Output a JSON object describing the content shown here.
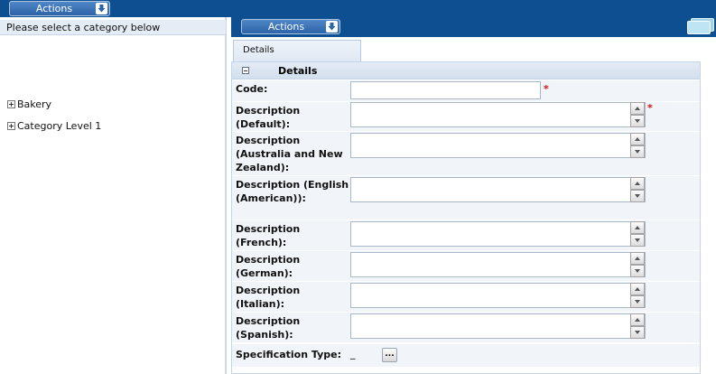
{
  "left_pane": {
    "actions_label": "Actions",
    "header": "Please select a category below",
    "tree": [
      {
        "label": "Bakery"
      },
      {
        "label": "Category Level 1"
      }
    ]
  },
  "right_pane": {
    "actions_label": "Actions",
    "tabs": [
      {
        "label": "Details"
      }
    ],
    "section_title": "Details",
    "fields": [
      {
        "label": "Code:",
        "value": "",
        "required": true
      },
      {
        "label": "Description (Default):",
        "value": "",
        "required": true
      },
      {
        "label": "Description (Australia and New Zealand):",
        "value": "",
        "required": false
      },
      {
        "label": "Description (English (American)):",
        "value": "",
        "required": false
      },
      {
        "label": "Description (French):",
        "value": "",
        "required": false
      },
      {
        "label": "Description (German):",
        "value": "",
        "required": false
      },
      {
        "label": "Description (Italian):",
        "value": "",
        "required": false
      },
      {
        "label": "Description (Spanish):",
        "value": "",
        "required": false
      }
    ],
    "specification_type": {
      "label": "Specification Type:",
      "value": "_",
      "lookup_label": "..."
    },
    "required_marker": "*"
  },
  "icons": {
    "actions_arrow": "down-arrow-icon",
    "tree_expand": "plus-box-icon",
    "section_collapse": "minus-box-icon",
    "window": "window-icon"
  },
  "colors": {
    "top_bar": "#0d4f91",
    "panel_header": "#dfe8f3",
    "row_bg": "#f1f4f8",
    "required": "#dd1111"
  }
}
